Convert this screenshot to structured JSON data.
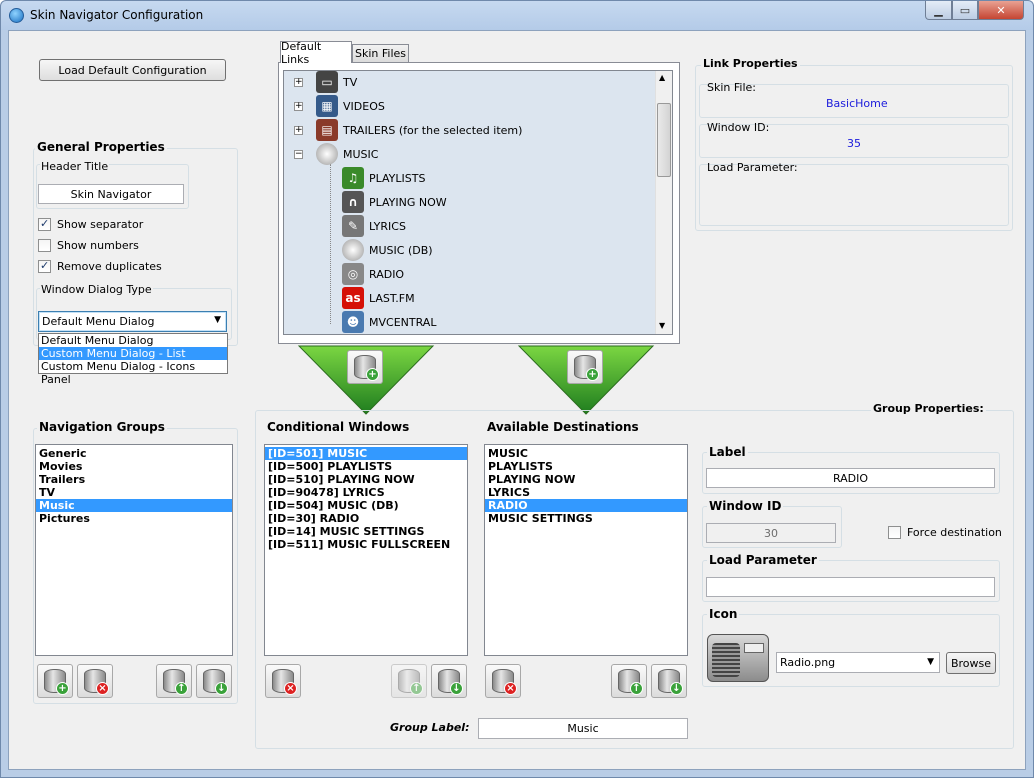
{
  "window": {
    "title": "Skin Navigator Configuration",
    "min_label": "▁",
    "max_label": "▭",
    "close_label": "✕"
  },
  "load_default_label": "Load Default Configuration",
  "general": {
    "title": "General Properties",
    "header_title_label": "Header Title",
    "header_title_value": "Skin Navigator",
    "show_separator": "Show separator",
    "show_numbers": "Show numbers",
    "remove_duplicates": "Remove duplicates",
    "dialog_type_label": "Window Dialog Type",
    "dialog_type_value": "Default Menu Dialog",
    "dialog_options": [
      "Default Menu Dialog",
      "Custom Menu Dialog - List",
      "Custom Menu Dialog - Icons Panel"
    ]
  },
  "tabs": {
    "default_links": "Default Links",
    "skin_files": "Skin Files"
  },
  "tree": {
    "items": [
      "TV",
      "VIDEOS",
      "TRAILERS (for the selected item)",
      "MUSIC",
      "PLAYLISTS",
      "PLAYING NOW",
      "LYRICS",
      "MUSIC (DB)",
      "RADIO",
      "LAST.FM",
      "MVCENTRAL"
    ]
  },
  "link_props": {
    "title": "Link Properties",
    "skin_file_label": "Skin File:",
    "skin_file_value": "BasicHome",
    "window_id_label": "Window ID:",
    "window_id_value": "35",
    "load_param_label": "Load Parameter:"
  },
  "nav_groups": {
    "title": "Navigation Groups",
    "items": [
      "Generic",
      "Movies",
      "Trailers",
      "TV",
      "Music",
      "Pictures"
    ]
  },
  "cond_windows": {
    "title": "Conditional Windows",
    "items": [
      "[ID=501] MUSIC",
      "[ID=500] PLAYLISTS",
      "[ID=510] PLAYING NOW",
      "[ID=90478] LYRICS",
      "[ID=504] MUSIC (DB)",
      "[ID=30] RADIO",
      "[ID=14] MUSIC SETTINGS",
      "[ID=511] MUSIC FULLSCREEN"
    ]
  },
  "avail_dest": {
    "title": "Available Destinations",
    "items": [
      "MUSIC",
      "PLAYLISTS",
      "PLAYING NOW",
      "LYRICS",
      "RADIO",
      "MUSIC SETTINGS"
    ]
  },
  "group_props": {
    "title": "Group Properties:",
    "label_title": "Label",
    "label_value": "RADIO",
    "window_id_title": "Window ID",
    "window_id_value": "30",
    "force_dest": "Force destination",
    "load_param_title": "Load Parameter",
    "icon_title": "Icon",
    "icon_value": "Radio.png",
    "browse": "Browse"
  },
  "group_label": {
    "label": "Group Label:",
    "value": "Music"
  }
}
